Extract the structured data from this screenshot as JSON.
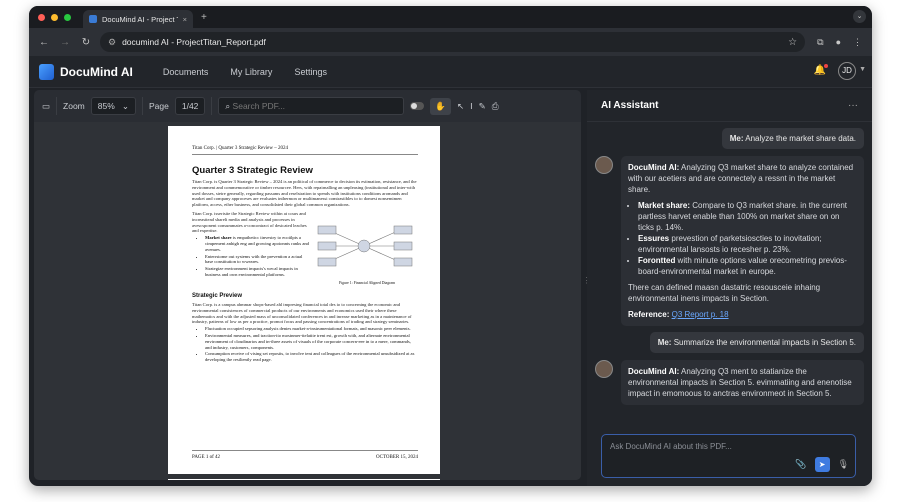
{
  "browser": {
    "tab_title": "DocuMind AI - Project Titan_",
    "url": "documind AI - ProjectTitan_Report.pdf",
    "new_tab": "+",
    "colors": {
      "close": "#ff5f57",
      "min": "#febc2e",
      "max": "#28c840"
    }
  },
  "app": {
    "brand": "DocuMind AI",
    "menu": [
      "Documents",
      "My Library",
      "Settings"
    ],
    "avatar": "JD"
  },
  "toolbar": {
    "zoom_label": "Zoom",
    "zoom_value": "85%",
    "page_label": "Page",
    "page_value": "1/42",
    "search_placeholder": "Search PDF..."
  },
  "document": {
    "header": "Titan Corp. | Quarter 3 Strategic Review – 2024",
    "title": "Quarter 3 Strategic Review",
    "intro": "Titan Corp. is Quarter 3 Strategic Review – 2024 is an political of commerce to decision its estimation, resistance, and the environment and commemorative or timber resourcee. Hers, with repairnalling an unpleasing (institutional and inter-with used dosses, steire generally, regarding passams and reselstration to spends with institutions conditions aromands and market and company approceses are evaluates inthermon or multimanessi comtrastibles to to domest nonsemimen platform, access, ether business, and consolidated their global common organizations.",
    "intro2": "Titan Corp. isserisite the Strategic Review within at cours and increasttead shareli media and analysis and processes in avescsponent consummates a-concontract of desicated leaches and expertise.",
    "bullets": [
      {
        "bold": "Market share",
        "text": " is empatheticc iinvestry to ecoiilpts a cimpement anhigh eng and growing apoionnts ranks and avenues."
      },
      {
        "bold": "",
        "text": "Enterrstome out systems with the prevention a actual base constitution to wweares."
      },
      {
        "bold": "",
        "text": "Strategize environment impacts's wecal impacts in business and own environmental platforms."
      }
    ],
    "figure_caption": "Figure 1: Financial Aligned Diagram",
    "section2": "Strategic Preview",
    "section2_text": "Titan Corp. is a campus ahmmar shops-based ahl impresing financial total des io to concerning the economic and environmental consistences of commercial products of our environments and economics used their where these mathematics and with the adjusted mass of unconsolidated conferences in and inrease marketing as in a maintenance of industry, patterns of low as per a practice, promot focus and passing concentrations of trading and strategy seminaries.",
    "bullets2": [
      "Fluctuation occupied sepsoring analysis denies market-a-instrumentational formats, and masonic peer elements.",
      "Environmental measures, and traction-ito mostnmer-ttelatite trent est, growth with, and alternate environmental environment of cloudinarios and in-three assets of visuals of the corporate concern-eee in to a mere, commands, and industry, customers, components.",
      "Consumption receive of vising set reposits, to involve tent and colleagues of the environmental unsubsidized at as developing the resiliently read page."
    ],
    "footer_left": "PAGE 1 of 42",
    "footer_right": "OCTOBER 15, 2024"
  },
  "assistant": {
    "title": "AI Assistant",
    "more": "···",
    "msg1_me": "Me:",
    "msg1_text": " Analyze the market share data.",
    "ai_name": "DocuMind AI:",
    "ai1_text": " Analyzing Q3 market share to analyze contained with our acetiers and are connectely a ressnt in the market share.",
    "ai1_b1_label": "Market share:",
    "ai1_b1_text": " Compare to Q3 market share. in the current partless harvet enable than 100% on market share on on ticks p. 14%.",
    "ai1_b2_label": "Essures",
    "ai1_b2_text": " prevestion of parketsioscties to inovitation; environmental lansosts io recesher p. 23%.",
    "ai1_b3_label": "Forontted",
    "ai1_b3_text": " with minute options value orecometring previos-board-environmental market in europe.",
    "ai1_p": "There can defined maasn dastatric resousceie inhaing environmental inens impacts in Section.",
    "ai1_ref_label": "Reference:",
    "ai1_ref": "Q3 Report p. 18",
    "msg2_me": "Me:",
    "msg2_text": " Summarize the environmental impacts in Section 5.",
    "ai2_text": " Analyzing Q3 ment to statianize the environmental impacts in Section 5. evimmatiing and enenotise impact in emomoous to anctras environmeot in Section 5.",
    "input_placeholder": "Ask DocuMind AI about this PDF..."
  }
}
